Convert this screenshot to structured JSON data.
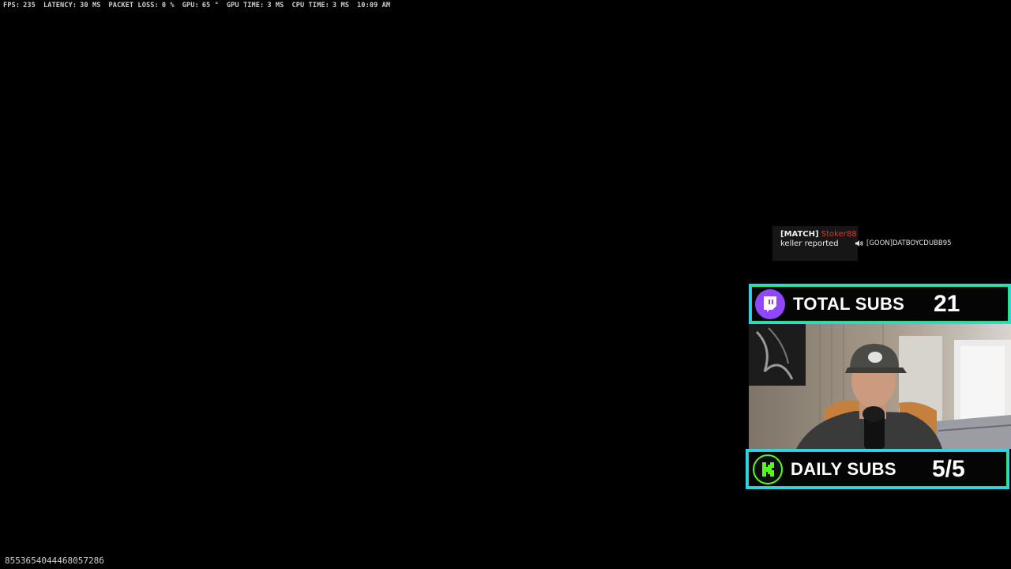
{
  "perf": [
    {
      "label": "FPS:",
      "value": "235"
    },
    {
      "label": "LATENCY:",
      "value": "30 MS"
    },
    {
      "label": "PACKET LOSS:",
      "value": "0 %"
    },
    {
      "label": "GPU:",
      "value": "65 °"
    },
    {
      "label": "GPU TIME:",
      "value": "3 MS"
    },
    {
      "label": "CPU TIME:",
      "value": "3 MS"
    },
    {
      "label": "",
      "value": "10:09 AM"
    }
  ],
  "session_id": "855365404446805728б",
  "notice": {
    "tag": "[MATCH]",
    "player": "Stoker88",
    "message": "keller reported",
    "player_color": "#e0352b"
  },
  "voice": {
    "icon": "speaker-icon",
    "name": "[GOON]DATBOYCDUBB95"
  },
  "overlay": {
    "total_subs": {
      "label": "TOTAL SUBS",
      "value": "21",
      "icon": "twitch-icon",
      "color": "#9146ff"
    },
    "daily_subs": {
      "label": "DAILY SUBS",
      "value": "5/5",
      "icon": "kick-icon",
      "color": "#53fc18"
    },
    "border_color": "#2fd4e0"
  }
}
